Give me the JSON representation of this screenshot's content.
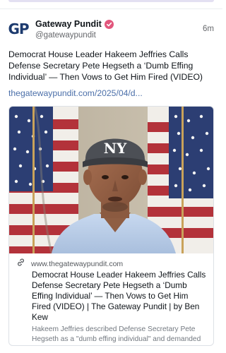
{
  "post": {
    "author_name": "Gateway Pundit",
    "author_handle": "@gatewaypundit",
    "avatar_text_g": "G",
    "avatar_text_p": "P",
    "time": "6m",
    "text": "Democrat House Leader Hakeem Jeffries Calls Defense Secretary Pete Hegseth a ‘Dumb Effing Individual’ — Then Vows to Get Him Fired (VIDEO)",
    "link": "thegatewaypundit.com/2025/04/d..."
  },
  "card": {
    "domain": "www.thegatewaypundit.com",
    "title": "Democrat House Leader Hakeem Jeffries Calls Defense Secretary Pete Hegseth a ‘Dumb Effing Individual’ — Then Vows to Get Him Fired (VIDEO) | The Gateway Pundit | by Ben Kew",
    "description": "Hakeem Jeffries described Defense Secretary Pete Hegseth as a \"dumb effing individual\" and demanded he be fired from the role.",
    "cap_logo": "NY"
  },
  "colors": {
    "badge": "#e2567c",
    "link": "#4b6fa9",
    "avatar": "#1c3a6e"
  },
  "icons": {
    "verified": "check-badge-icon",
    "link": "link-icon"
  }
}
